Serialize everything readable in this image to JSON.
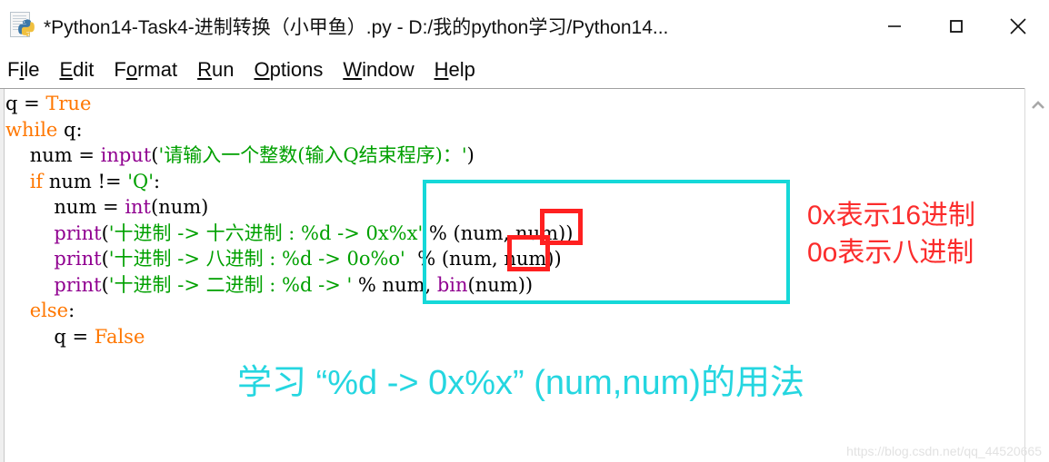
{
  "window": {
    "title": "*Python14-Task4-进制转换（小甲鱼）.py - D:/我的python学习/Python14...",
    "icon": "python-file-icon",
    "controls": {
      "minimize": "minimize-icon",
      "maximize": "maximize-icon",
      "close": "close-icon"
    }
  },
  "menubar": {
    "items": [
      {
        "label": "File",
        "accel_prefix": "F",
        "accel": "i",
        "accel_suffix": "le"
      },
      {
        "label": "Edit",
        "accel_prefix": "",
        "accel": "E",
        "accel_suffix": "dit"
      },
      {
        "label": "Format",
        "accel_prefix": "F",
        "accel": "o",
        "accel_suffix": "rmat"
      },
      {
        "label": "Run",
        "accel_prefix": "",
        "accel": "R",
        "accel_suffix": "un"
      },
      {
        "label": "Options",
        "accel_prefix": "",
        "accel": "O",
        "accel_suffix": "ptions"
      },
      {
        "label": "Window",
        "accel_prefix": "",
        "accel": "W",
        "accel_suffix": "indow"
      },
      {
        "label": "Help",
        "accel_prefix": "",
        "accel": "H",
        "accel_suffix": "elp"
      }
    ]
  },
  "editor": {
    "lines": [
      [
        {
          "t": "q = ",
          "c": "norm"
        },
        {
          "t": "True",
          "c": "kw"
        }
      ],
      [
        {
          "t": "while",
          "c": "kw"
        },
        {
          "t": " q:",
          "c": "norm"
        }
      ],
      [
        {
          "t": "    num = ",
          "c": "norm"
        },
        {
          "t": "input",
          "c": "bi"
        },
        {
          "t": "(",
          "c": "norm"
        },
        {
          "t": "'请输入一个整数(输入Q结束程序)：'",
          "c": "str"
        },
        {
          "t": ")",
          "c": "norm"
        }
      ],
      [
        {
          "t": "    ",
          "c": "norm"
        },
        {
          "t": "if",
          "c": "kw"
        },
        {
          "t": " num != ",
          "c": "norm"
        },
        {
          "t": "'Q'",
          "c": "str"
        },
        {
          "t": ":",
          "c": "norm"
        }
      ],
      [
        {
          "t": "        num = ",
          "c": "norm"
        },
        {
          "t": "int",
          "c": "bi"
        },
        {
          "t": "(num)",
          "c": "norm"
        }
      ],
      [
        {
          "t": "        ",
          "c": "norm"
        },
        {
          "t": "print",
          "c": "bi"
        },
        {
          "t": "(",
          "c": "norm"
        },
        {
          "t": "'十进制 -> 十六进制 : %d -> 0x%x'",
          "c": "str"
        },
        {
          "t": " % (num, num))",
          "c": "norm"
        }
      ],
      [
        {
          "t": "        ",
          "c": "norm"
        },
        {
          "t": "print",
          "c": "bi"
        },
        {
          "t": "(",
          "c": "norm"
        },
        {
          "t": "'十进制 -> 八进制 : %d -> 0o%o'",
          "c": "str"
        },
        {
          "t": "  % (num, num))",
          "c": "norm"
        }
      ],
      [
        {
          "t": "        ",
          "c": "norm"
        },
        {
          "t": "print",
          "c": "bi"
        },
        {
          "t": "(",
          "c": "norm"
        },
        {
          "t": "'十进制 -> 二进制 : %d -> '",
          "c": "str"
        },
        {
          "t": " % num, ",
          "c": "norm"
        },
        {
          "t": "bin",
          "c": "bi"
        },
        {
          "t": "(num))",
          "c": "norm"
        }
      ],
      [
        {
          "t": "    ",
          "c": "norm"
        },
        {
          "t": "else",
          "c": "kw"
        },
        {
          "t": ":",
          "c": "norm"
        }
      ],
      [
        {
          "t": "        q = ",
          "c": "norm"
        },
        {
          "t": "False",
          "c": "kw"
        }
      ]
    ]
  },
  "annotations": {
    "cyan_box": {
      "name": "format-spec-highlight-box",
      "color": "#15d8d8"
    },
    "red_box_hex": {
      "name": "hex-prefix-highlight-box",
      "color": "#ff2020"
    },
    "red_box_oct": {
      "name": "oct-prefix-highlight-box",
      "color": "#ff2020"
    },
    "red_note_1": "0x表示16进制",
    "red_note_2": "0o表示八进制",
    "red_note_color": "#fb2c2c",
    "cyan_caption": "学习 “%d -> 0x%x” (num,num)的用法",
    "cyan_caption_color": "#25d6e0"
  },
  "scrollbar": {
    "up_arrow": "chevron-up-icon"
  },
  "watermark": "https://blog.csdn.net/qq_44520665"
}
